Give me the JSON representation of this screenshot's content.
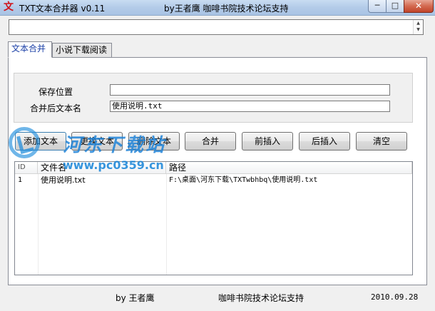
{
  "window": {
    "title": "TXT文本合并器 v0.11",
    "title_by": "by王者鹰 咖啡书院技术论坛支持",
    "app_icon": "文",
    "minimize_glyph": "─",
    "maximize_glyph": "□",
    "close_glyph": "✕"
  },
  "log_field": {
    "value": "",
    "scroll_up": "▲",
    "scroll_down": "▼"
  },
  "tabs": [
    {
      "label": "文本合并",
      "active": true
    },
    {
      "label": "小说下载阅读",
      "active": false
    }
  ],
  "form": {
    "save_label": "保存位置",
    "save_value": "",
    "merged_name_label": "合并后文本名",
    "merged_name_value": "使用说明.txt"
  },
  "buttons": {
    "add": "添加文本",
    "replace": "更换文本",
    "delete": "删除文本",
    "merge": "合并",
    "insert_before": "前插入",
    "insert_after": "后插入",
    "clear": "清空"
  },
  "list": {
    "columns": [
      "ID",
      "文件名",
      "路径"
    ],
    "rows": [
      {
        "id": "1",
        "name": "使用说明.txt",
        "path": "F:\\桌面\\河东下载\\TXTwbhbq\\使用说明.txt"
      }
    ]
  },
  "status": {
    "author": "by 王者鹰",
    "forum": "咖啡书院技术论坛支持",
    "date": "2010.09.28"
  },
  "watermark": {
    "title": "河东下载站",
    "url": "www.pc0359.cn"
  },
  "colors": {
    "accent": "#1a3fa6",
    "close_button": "#c1442a",
    "watermark": "#1e82d7"
  }
}
